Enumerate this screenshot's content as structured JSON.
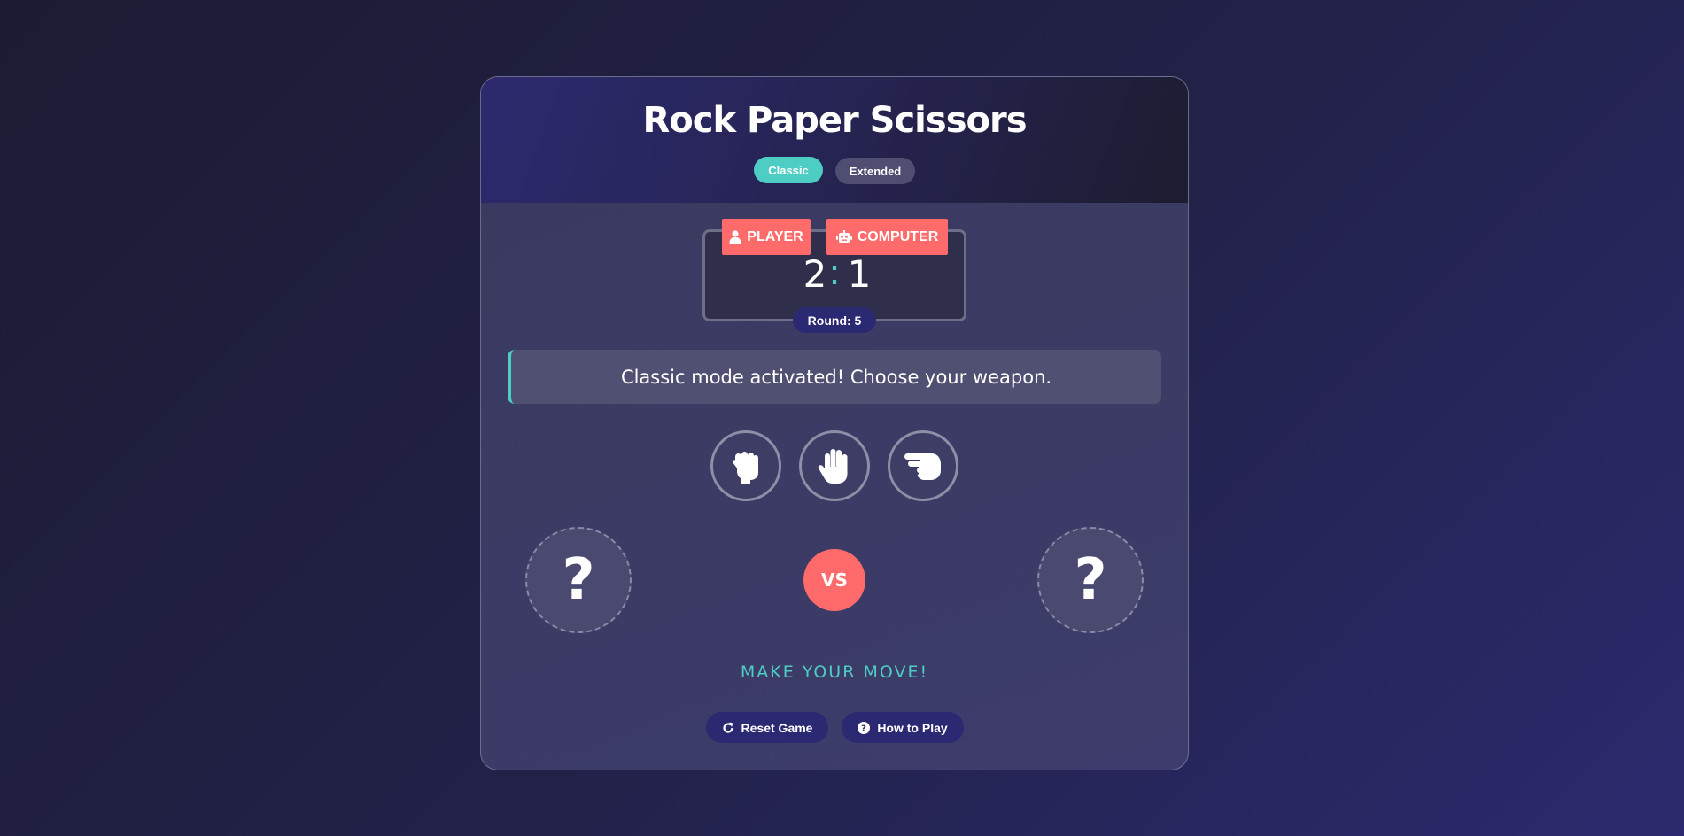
{
  "header": {
    "title": "Rock Paper Scissors",
    "modes": [
      {
        "label": "Classic",
        "active": true
      },
      {
        "label": "Extended",
        "active": false
      }
    ]
  },
  "scoreboard": {
    "player_label": "PLAYER",
    "computer_label": "COMPUTER",
    "player_score": "2",
    "separator": ":",
    "computer_score": "1",
    "round_text": "Round: 5"
  },
  "message": "Classic mode activated! Choose your weapon.",
  "weapons": [
    {
      "name": "rock",
      "icon": "hand-rock-icon"
    },
    {
      "name": "paper",
      "icon": "hand-paper-icon"
    },
    {
      "name": "scissors",
      "icon": "hand-scissors-icon"
    }
  ],
  "arena": {
    "player_choice": "?",
    "vs_label": "VS",
    "computer_choice": "?"
  },
  "result_text": "MAKE YOUR MOVE!",
  "actions": {
    "reset_label": "Reset Game",
    "howto_label": "How to Play"
  },
  "colors": {
    "accent": "#4ecdc4",
    "danger": "#ff6b6b",
    "pill": "#2a2972"
  }
}
